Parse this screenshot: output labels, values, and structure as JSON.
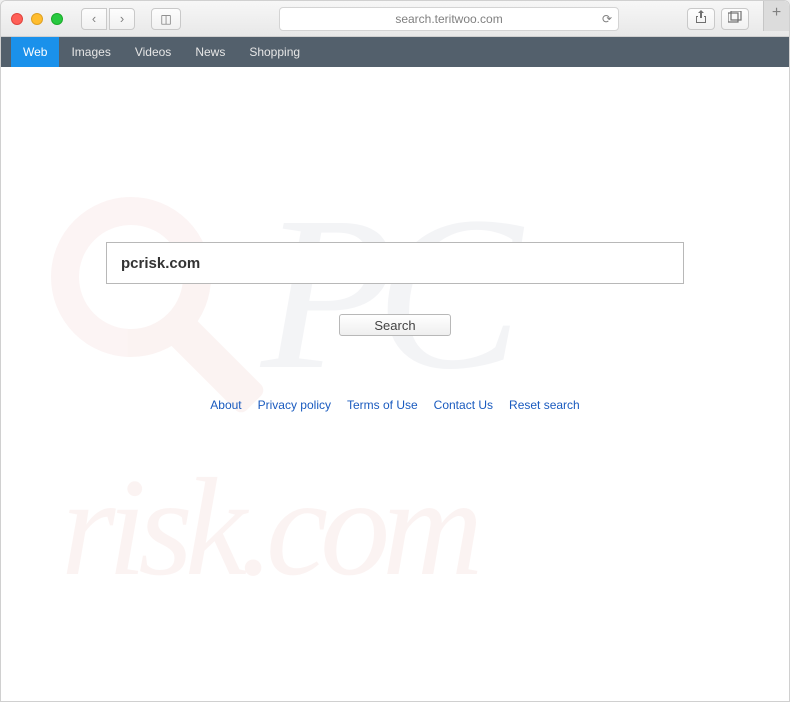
{
  "browser": {
    "url": "search.teritwoo.com"
  },
  "navbar": {
    "items": [
      {
        "label": "Web",
        "active": true
      },
      {
        "label": "Images",
        "active": false
      },
      {
        "label": "Videos",
        "active": false
      },
      {
        "label": "News",
        "active": false
      },
      {
        "label": "Shopping",
        "active": false
      }
    ]
  },
  "search": {
    "value": "pcrisk.com",
    "button": "Search"
  },
  "footer": {
    "links": [
      "About",
      "Privacy policy",
      "Terms of Use",
      "Contact Us",
      "Reset search"
    ]
  },
  "watermark": {
    "pc": "PC",
    "risk": "risk.com"
  }
}
